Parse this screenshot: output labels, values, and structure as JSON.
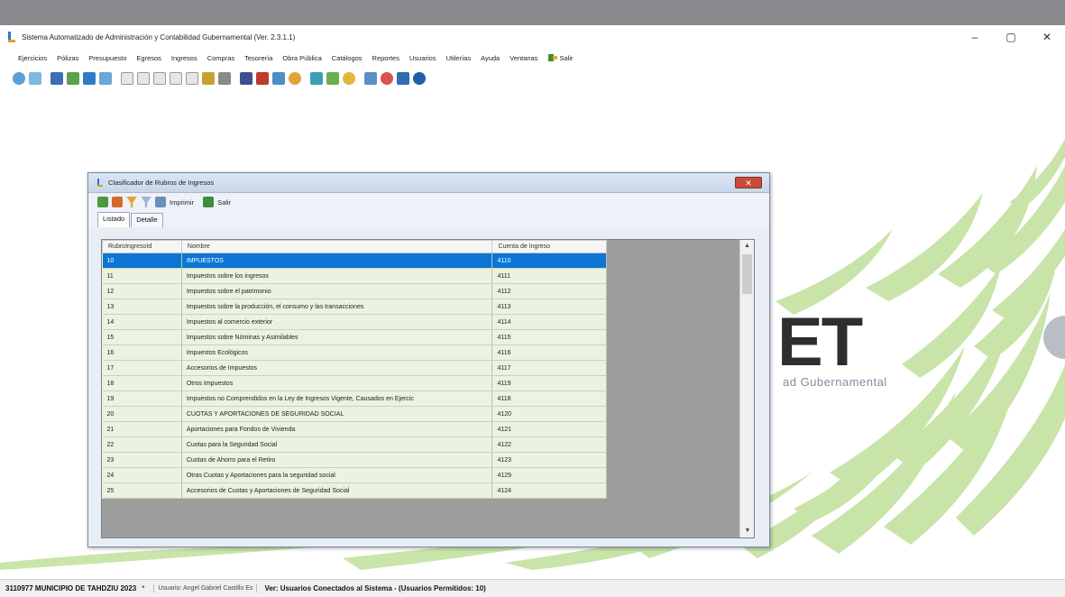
{
  "window": {
    "title": "Sistema Automatizado de Administración y Contabilidad Gubernamental (Ver. 2.3.1.1)",
    "minimize": "–",
    "maximize": "▢",
    "close": "✕"
  },
  "menu": [
    "Ejercicios",
    "Pólizas",
    "Presupuesto",
    "Egresos",
    "Ingresos",
    "Compras",
    "Tesorería",
    "Obra Pública",
    "Catálogos",
    "Reportes",
    "Usuarios",
    "Utilerías",
    "Ayuda",
    "Ventanas",
    "Salir"
  ],
  "logo": {
    "text": "ET",
    "subtitle": "ad Gubernamental"
  },
  "dialog": {
    "title": "Clasificador de Rubros de Ingresos",
    "close": "✕",
    "toolbar": {
      "print_label": "Imprimir",
      "exit_label": "Salir"
    },
    "tabs": [
      "Listado",
      "Detalle"
    ],
    "columns": [
      "RubroIngresoId",
      "Nombre",
      "Cuenta de Ingreso"
    ],
    "rows": [
      [
        "10",
        "IMPUESTOS",
        "4110"
      ],
      [
        "11",
        "Impuestos sobre los ingresos",
        "4111"
      ],
      [
        "12",
        "Impuestos sobre el patrimonio",
        "4112"
      ],
      [
        "13",
        "Impuestos sobre la producción, el consumo y las transacciones",
        "4113"
      ],
      [
        "14",
        "Impuestos al comercio exterior",
        "4114"
      ],
      [
        "15",
        "Impuestos sobre Nóminas y Asimilables",
        "4115"
      ],
      [
        "16",
        "Impuestos Ecológicos",
        "4116"
      ],
      [
        "17",
        "Accesorios de Impuestos",
        "4117"
      ],
      [
        "18",
        "Otros Impuestos",
        "4119"
      ],
      [
        "19",
        "Impuestos no Comprendidos en la Ley de Ingresos Vigente, Causados en Ejercic",
        "4118"
      ],
      [
        "20",
        "CUOTAS Y APORTACIONES DE SEGURIDAD SOCIAL",
        "4120"
      ],
      [
        "21",
        "Aportaciones para Fondos de Vivienda",
        "4121"
      ],
      [
        "22",
        "Cuotas para la Seguridad Social",
        "4122"
      ],
      [
        "23",
        "Cuotas de Ahorro para el Retiro",
        "4123"
      ],
      [
        "24",
        "Otras Cuotas y Aportaciones para la seguridad social",
        "4129"
      ],
      [
        "25",
        "Accesorios de Cuotas y Aportaciones de Seguridad Social",
        "4124"
      ]
    ],
    "selected_row": 0
  },
  "status": {
    "company": "3110977 MUNICIPIO DE TAHDZIU 2023",
    "star": "*",
    "user": "Usuario: Angel Gabriel Castillo Es",
    "version": "Ver: Usuarios Conectados al Sistema - (Usuarios Permitidos: 10)"
  },
  "colors": {
    "selection": "#0b76d6",
    "row_background": "#eaf3df",
    "grid_empty": "#9d9d9d",
    "swoosh": "#b9d98f"
  }
}
